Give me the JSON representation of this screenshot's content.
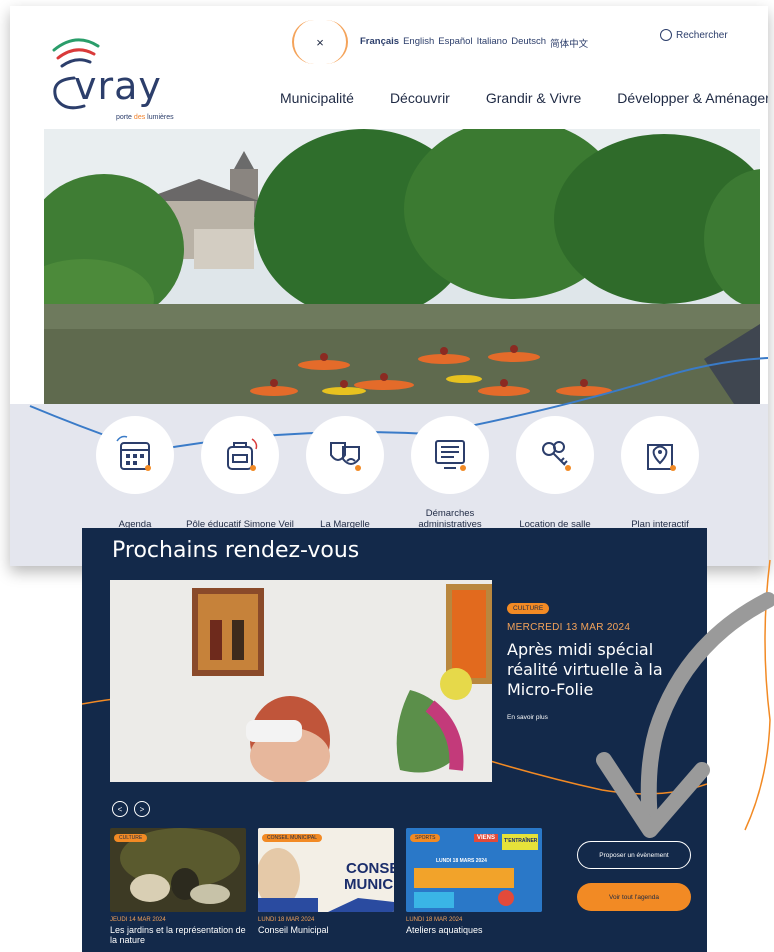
{
  "header": {
    "logo_word": "vray",
    "logo_tagline_a": "porte",
    "logo_tagline_b": "des",
    "logo_tagline_c": "lumières",
    "close_glyph": "×",
    "languages": [
      "Français",
      "English",
      "Español",
      "Italiano",
      "Deutsch",
      "简体中文"
    ],
    "search_label": "Rechercher",
    "search_icon": "search-icon"
  },
  "nav": {
    "items": [
      "Municipalité",
      "Découvrir",
      "Grandir & Vivre",
      "Développer & Aménager"
    ]
  },
  "quick_links": [
    {
      "label": "Agenda",
      "icon": "calendar-icon"
    },
    {
      "label": "Pôle éducatif Simone Veil",
      "icon": "school-bag-icon"
    },
    {
      "label": "La Margelle",
      "icon": "theatre-masks-icon"
    },
    {
      "label": "Démarches administratives",
      "icon": "form-screen-icon"
    },
    {
      "label": "Location de salle",
      "icon": "keys-icon"
    },
    {
      "label": "Plan interactif",
      "icon": "map-pin-icon"
    }
  ],
  "agenda": {
    "title": "Prochains rendez-vous",
    "featured": {
      "badge": "Culture",
      "date": "MERCREDI 13 MAR 2024",
      "title": "Après midi spécial réalité virtuelle à la Micro-Folie",
      "more": "En savoir plus"
    },
    "prev_glyph": "<",
    "next_glyph": ">",
    "cards": [
      {
        "badge": "Culture",
        "date": "JEUDI 14 MAR 2024",
        "title": "Les jardins et la représentation de la nature"
      },
      {
        "badge": "Conseil municipal",
        "date": "LUNDI 18 MAR 2024",
        "title": "Conseil Municipal",
        "thumb_text_1": "CONSE",
        "thumb_text_2": "MUNICI"
      },
      {
        "badge": "Sports",
        "date": "LUNDI 18 MAR 2024",
        "title": "Ateliers aquatiques",
        "thumb_text_1": "VIENS",
        "thumb_text_2": "T'ENTRAÎNER",
        "thumb_text_3": "LUNDI 18 MARS 2024"
      }
    ],
    "propose_button": "Proposer un évènement",
    "all_button": "Voir tout l'agenda"
  },
  "colors": {
    "accent_orange": "#f28a24",
    "navy": "#13294a",
    "wave_blue": "#3a7bc8",
    "band_grey": "#e4e6ee"
  }
}
